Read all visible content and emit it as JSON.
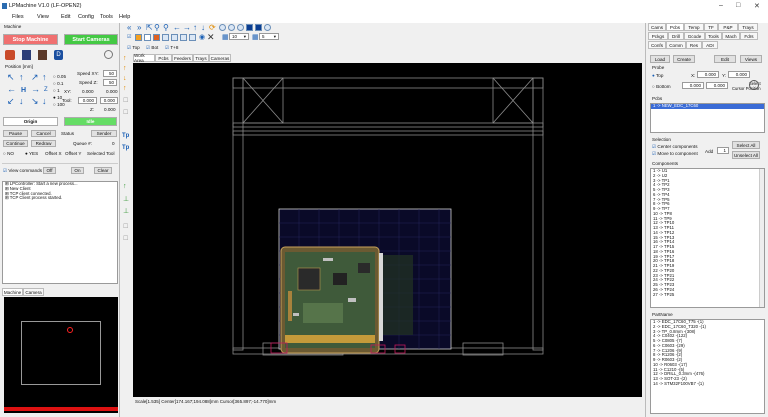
{
  "window": {
    "title": "LPMachine V1.0 (LF-OPEN2)"
  },
  "menu": [
    "Files",
    "View",
    "Edit",
    "Config",
    "Tools",
    "Help"
  ],
  "left": {
    "header": "Machine",
    "stop_cameras": "Stop Machine",
    "start_cameras": "Start Cameras",
    "position_label": "Position [mm]",
    "step_values": [
      "0.05",
      "0.1",
      "1",
      "10",
      "100"
    ],
    "speed_xy_label": "Speed XY:",
    "speed_xy": "50",
    "speed_z_label": "Speed Z:",
    "speed_z": "50",
    "xy_label": "XY:",
    "x_val": "0.000",
    "y_val": "0.000",
    "tool_label": "Tool:",
    "t1_val": "0.000",
    "t2_val": "0.000",
    "z_label": "Z:",
    "z_val": "0.000",
    "origin_btn": "Origin",
    "idle_btn": "Idle",
    "pause_btn": "Pause",
    "cancel_btn": "Cancel",
    "status_label": "Status",
    "sender_btn": "Sender",
    "continue_btn": "Continue",
    "redraw_btn": "Redraw",
    "queue_label": "Queue #:",
    "queue_val": "0",
    "no_label": "NO",
    "yes_label": "YES",
    "offset_x": "Offset X",
    "offset_y": "Offset Y",
    "selected_tool": "Selected Tool",
    "view_commands": "View commands",
    "off_btn": "Off",
    "on_btn": "On",
    "clear_btn": "Clear",
    "log": [
      "LPController: Start a new process...",
      "New Client",
      "TCP client connected.",
      "TCP Client process started."
    ],
    "bottom_tabs": [
      "Machine",
      "Camera"
    ]
  },
  "toolbar": {
    "top_label": "Top",
    "bot_label": "Bot",
    "t8_label": "T+8",
    "zoom_val": "10",
    "step_val": "5"
  },
  "center": {
    "tabs": [
      "Work Area",
      "Pcbs",
      "Feeders",
      "Trays",
      "Cameras"
    ],
    "status": "Scale[1.535]  Center[174.167;194.088]mm   Cursor[365.897;-14.770]mm"
  },
  "right": {
    "tabs_row1": [
      "Cams",
      "Pcbs",
      "Temp",
      "TF",
      "P&P",
      "Trays"
    ],
    "tabs_row2": [
      "Pckgs",
      "Drill",
      "Gcode",
      "Tools",
      "Mach",
      "Fdrs"
    ],
    "tabs_row3": [
      "Confs",
      "Comm",
      "Res",
      "ADI"
    ],
    "load_btn": "Load",
    "create_btn": "Create",
    "edit_btn": "Edit",
    "views_btn": "Views",
    "probe_label": "Probe",
    "top_radio": "Top",
    "bottom_radio": "Bottom",
    "x_label": "X:",
    "y_label": "Y:",
    "px_val": "0.000",
    "py_val": "0.000",
    "bx_val": "0.000",
    "by_val": "0.000",
    "select_cursor": "Select\nCursor Position",
    "pcbs_label": "Pcbs",
    "pcb_item": "1 -> NEW_EDC_17C60",
    "selection_label": "Selection",
    "center_components": "Center components",
    "move_to_component": "Move to component",
    "add_label": "Add",
    "add_val": "1",
    "select_all": "Select All",
    "unselect_all": "Unselect All",
    "components_label": "Components",
    "components": [
      "1 -> U1",
      "2 -> U2",
      "3 -> TP1",
      "4 -> TP2",
      "5 -> TP3",
      "6 -> TP4",
      "7 -> TP5",
      "8 -> TP6",
      "9 -> TP7",
      "10 -> TP8",
      "11 -> TP9",
      "12 -> TP10",
      "13 -> TP11",
      "14 -> TP12",
      "15 -> TP13",
      "16 -> TP14",
      "17 -> TP15",
      "18 -> TP16",
      "19 -> TP17",
      "20 -> TP18",
      "21 -> TP19",
      "22 -> TP20",
      "23 -> TP21",
      "24 -> TP22",
      "25 -> TP23",
      "26 -> TP24",
      "27 -> TP25"
    ],
    "partname_label": "PartName",
    "parts": [
      "1 -> EDC_17C60_T75 -(1)",
      "2 -> EDC_17C60_T320 -(1)",
      "3 -> TP_0.8mm -(308)",
      "4 -> C0402 -(122)",
      "5 -> C0805 -(7)",
      "6 -> C0603 -(29)",
      "7 -> C1206 -(9)",
      "8 -> R1206 -(2)",
      "9 -> R0603 -(2)",
      "10 -> R0603 -(17)",
      "11 -> C1210 -(5)",
      "12 -> DRILL_0.3mm -(476)",
      "13 -> SOT-23 -(2)",
      "14 -> STM32F100VB7 -(1)"
    ]
  }
}
